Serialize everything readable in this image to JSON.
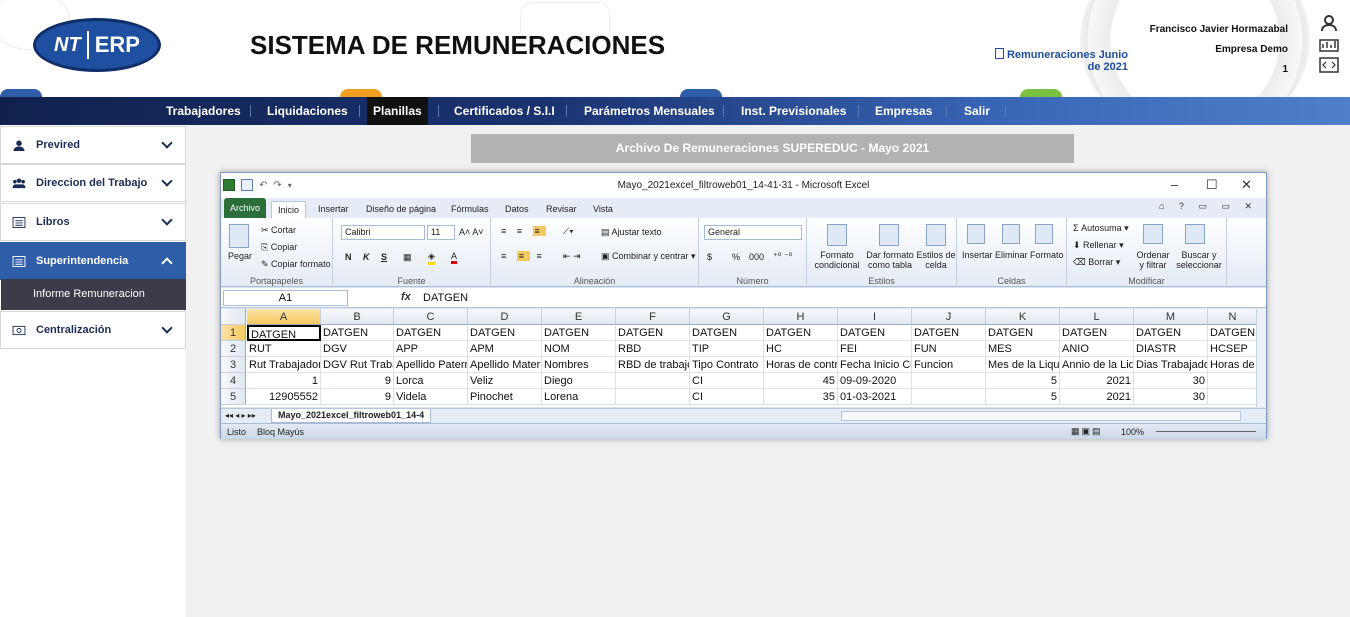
{
  "header": {
    "logo_left": "NT",
    "logo_right": "ERP",
    "title": "SISTEMA DE REMUNERACIONES",
    "document_link": "Remuneraciones Junio de 2021",
    "user_name": "Francisco Javier Hormazabal",
    "company": "Empresa Demo",
    "number": "1",
    "icons": [
      "user-icon",
      "dashboard-icon",
      "code-icon"
    ],
    "colors": {
      "brand": "#1f4fa0",
      "nav": "#1a3270",
      "accent": "#2f5ea9"
    }
  },
  "nav": {
    "items": [
      {
        "label": "Trabajadores",
        "active": false
      },
      {
        "label": "Liquidaciones",
        "active": false
      },
      {
        "label": "Planillas",
        "active": true
      },
      {
        "label": "Certificados / S.I.I",
        "active": false
      },
      {
        "label": "Parámetros Mensuales",
        "active": false
      },
      {
        "label": "Inst. Previsionales",
        "active": false
      },
      {
        "label": "Empresas",
        "active": false
      },
      {
        "label": "Salir",
        "active": false
      }
    ]
  },
  "sidebar": {
    "items": [
      {
        "label": "Previred",
        "icon": "user-icon"
      },
      {
        "label": "Direccion del Trabajo",
        "icon": "users-icon"
      },
      {
        "label": "Libros",
        "icon": "list-icon"
      },
      {
        "label": "Superintendencia",
        "icon": "list-icon",
        "active": true
      },
      {
        "label": "Centralización",
        "icon": "money-icon"
      }
    ],
    "subitem": "Informe Remuneracion"
  },
  "banner": "Archivo De Remuneraciones SUPEREDUC - Mayo 2021",
  "excel": {
    "window_title": "Mayo_2021excel_filtroweb01_14-41-31  -  Microsoft Excel",
    "tabs": [
      "Archivo",
      "Inicio",
      "Insertar",
      "Diseño de página",
      "Fórmulas",
      "Datos",
      "Revisar",
      "Vista"
    ],
    "ribbon": {
      "paste": "Pegar",
      "cut": "Cortar",
      "copy": "Copiar",
      "format_painter": "Copiar formato",
      "font": "Calibri",
      "size": "11",
      "wrap": "Ajustar texto",
      "merge": "Combinar y centrar",
      "number_format": "General",
      "currency": "$",
      "percent": "%",
      "thousands": "000",
      "cond_format": "Formato condicional",
      "table_format": "Dar formato como tabla",
      "cell_styles": "Estilos de celda",
      "insert": "Insertar",
      "delete": "Eliminar",
      "format": "Formato",
      "autosum": "Autosuma",
      "fill": "Rellenar",
      "clear": "Borrar",
      "sort": "Ordenar y filtrar",
      "find": "Buscar y seleccionar",
      "groups": [
        "Portapapeles",
        "Fuente",
        "Alineación",
        "Número",
        "Estilos",
        "Celdas",
        "Modificar"
      ],
      "bold": "N",
      "italic": "K",
      "underline": "S"
    },
    "namebox": "A1",
    "fx": "fx",
    "formula": "DATGEN",
    "columns": [
      "A",
      "B",
      "C",
      "D",
      "E",
      "F",
      "G",
      "H",
      "I",
      "J",
      "K",
      "L",
      "M",
      "N"
    ],
    "rows": [
      {
        "n": "1",
        "cells": [
          "DATGEN",
          "DATGEN",
          "DATGEN",
          "DATGEN",
          "DATGEN",
          "DATGEN",
          "DATGEN",
          "DATGEN",
          "DATGEN",
          "DATGEN",
          "DATGEN",
          "DATGEN",
          "DATGEN",
          "DATGEN"
        ]
      },
      {
        "n": "2",
        "cells": [
          "RUT",
          "DGV",
          "APP",
          "APM",
          "NOM",
          "RBD",
          "TIP",
          "HC",
          "FEI",
          "FUN",
          "MES",
          "ANIO",
          "DIASTR",
          "HCSEP"
        ]
      },
      {
        "n": "3",
        "cells": [
          "Rut Trabajador",
          "DGV Rut Trabajador",
          "Apellido Paterno",
          "Apellido Materno",
          "Nombres",
          "RBD de trabajo",
          "Tipo Contrato",
          "Horas de contrato",
          "Fecha Inicio Contrato",
          "Funcion",
          "Mes de la Liquidacion",
          "Annio de la Liquidacion",
          "Dias Trabajados",
          "Horas de"
        ]
      },
      {
        "n": "4",
        "cells": [
          "1",
          "9",
          "Lorca",
          "Veliz",
          "Diego",
          "",
          "CI",
          "45",
          "09-09-2020",
          "",
          "5",
          "2021",
          "30",
          ""
        ]
      },
      {
        "n": "5",
        "cells": [
          "12905552",
          "9",
          "Videla",
          "Pinochet",
          "Lorena",
          "",
          "CI",
          "35",
          "01-03-2021",
          "",
          "5",
          "2021",
          "30",
          ""
        ]
      }
    ],
    "sheet": "Mayo_2021excel_filtroweb01_14-4",
    "status": [
      "Listo",
      "Bloq Mayús"
    ],
    "zoom": "100%"
  }
}
